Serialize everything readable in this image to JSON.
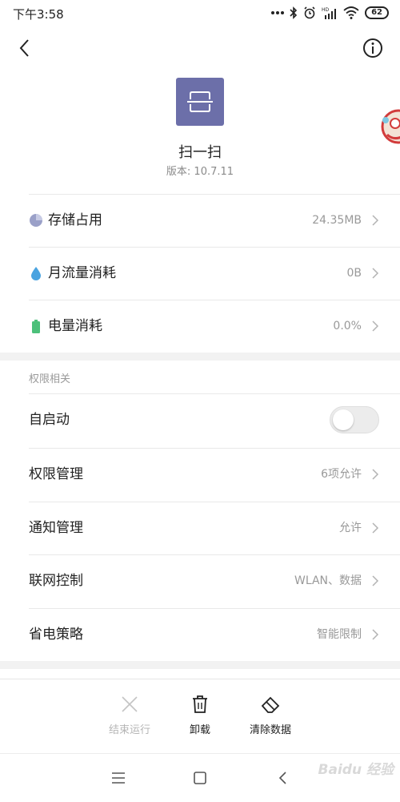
{
  "status": {
    "time": "下午3:58",
    "battery": "62"
  },
  "app": {
    "name": "扫一扫",
    "version": "版本: 10.7.11"
  },
  "usage": [
    {
      "label": "存储占用",
      "value": "24.35MB",
      "icon": "pie-chart-icon"
    },
    {
      "label": "月流量消耗",
      "value": "0B",
      "icon": "water-drop-icon"
    },
    {
      "label": "电量消耗",
      "value": "0.0%",
      "icon": "battery-icon"
    }
  ],
  "permissions": {
    "section_title": "权限相关",
    "autostart_label": "自启动",
    "autostart_on": false,
    "items": [
      {
        "label": "权限管理",
        "value": "6项允许"
      },
      {
        "label": "通知管理",
        "value": "允许"
      },
      {
        "label": "联网控制",
        "value": "WLAN、数据"
      },
      {
        "label": "省电策略",
        "value": "智能限制"
      }
    ]
  },
  "actions": {
    "stop": "结束运行",
    "uninstall": "卸载",
    "clear": "清除数据"
  },
  "colors": {
    "app_icon": "#6c6fa9",
    "pie": "#9aa0c8",
    "drop": "#4aa3e0",
    "battery": "#4cc07a"
  },
  "watermark": "Baidu 经验"
}
